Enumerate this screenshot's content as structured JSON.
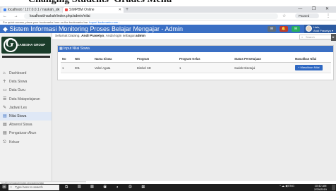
{
  "caption": {
    "text": "Changing Students' Grades Menu"
  },
  "browser": {
    "tabs": [
      {
        "label": "localhost / 127.0.0.1 / naskah_sk"
      },
      {
        "label": "SIMPBM Online"
      }
    ],
    "new_tab": "+",
    "window_controls": "— ❐ ✕",
    "nav": "← → C ⓘ",
    "url_host": "localhost",
    "url_path": "/naskah/index.php/admin/nilai",
    "paused_label": "Paused",
    "bookmarks_text": "For quick access, place your bookmarks here on the bookmarks bar.",
    "bookmarks_link": "Import bookmarks now..."
  },
  "app": {
    "title": "Sistem Informasi Monitoring Proses Belajar Mengajar - Admin",
    "header_icons": [
      "✉",
      "🔔",
      "✉"
    ],
    "user_greeting": "Halo,",
    "user_name": "Andi Prasetyo",
    "welcome_prefix": "Selamat Datang,",
    "welcome_name": "Andi Prasetyo",
    "welcome_middle": ", Anda login sebagai",
    "welcome_role": "admin",
    "search_placeholder": "Search"
  },
  "sidebar": {
    "logo_text": "GANESHA GROUP",
    "items": [
      {
        "label": "Dashboard",
        "icon": "dashboard-icon",
        "glyph": "⌂",
        "active": false
      },
      {
        "label": "Data Siswa",
        "icon": "student-icon",
        "glyph": "☥",
        "active": false
      },
      {
        "label": "Data Guru",
        "icon": "teacher-icon",
        "glyph": "▭",
        "active": false
      },
      {
        "label": "Data Matapelajaran",
        "icon": "subject-icon",
        "glyph": "☰",
        "active": false
      },
      {
        "label": "Jadwal Les",
        "icon": "schedule-icon",
        "glyph": "✎",
        "active": false
      },
      {
        "label": "Nilai Siswa",
        "icon": "grades-icon",
        "glyph": "▤",
        "active": true
      },
      {
        "label": "Absensi Siswa",
        "icon": "attendance-icon",
        "glyph": "▤",
        "active": false
      },
      {
        "label": "Pengaturan Akun",
        "icon": "settings-icon",
        "glyph": "▤",
        "active": false
      },
      {
        "label": "Keluar",
        "icon": "logout-icon",
        "glyph": "⎋",
        "active": false
      }
    ]
  },
  "panel": {
    "title": "Input Nilai Siswa",
    "columns": [
      "No",
      "NIS",
      "Nama Siswa",
      "Program",
      "Program Kelas",
      "Status Persetujuan",
      "Masukkan Nilai"
    ],
    "rows": [
      {
        "no": "1",
        "nis": "001",
        "nama": "Valeri Agata",
        "program": "Bimbel SD",
        "kelas": "1",
        "status": "Sudah Disetujui",
        "action": "+ Masukkan Nilai"
      }
    ]
  },
  "statusbar": {
    "text": "localhost/naskah/index.php/admin/nilai"
  },
  "taskbar": {
    "search_placeholder": "Type here to search",
    "tray_text": "^ ☁ ◀ ENG",
    "time": "10:42 AM",
    "date": "2/29/2019"
  }
}
